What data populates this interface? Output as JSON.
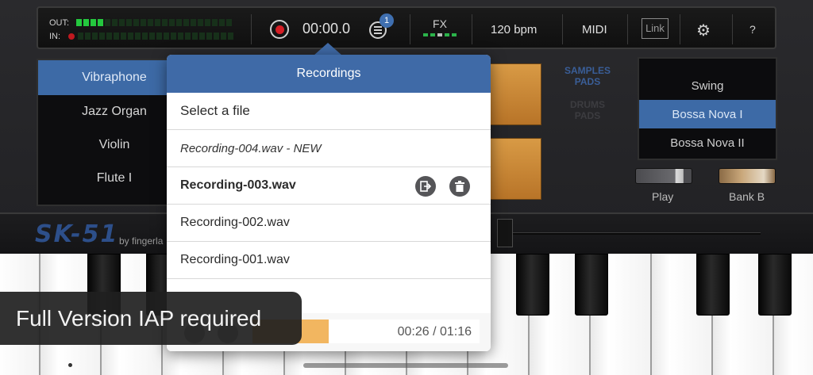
{
  "toolbar": {
    "out_label": "OUT:",
    "in_label": "IN:",
    "out_level": 0.2,
    "in_level": 0.0,
    "time": "00:00.0",
    "recordings_badge": "1",
    "fx_label": "FX",
    "bpm": "120 bpm",
    "midi_label": "MIDI",
    "link_label": "Link",
    "help_label": "?"
  },
  "instruments": {
    "items": [
      "Vibraphone",
      "Jazz Organ",
      "Violin",
      "Flute I"
    ],
    "selected": "Vibraphone"
  },
  "pads": {
    "samples_label_1": "SAMPLES",
    "samples_label_2": "PADS",
    "drums_label_1": "DRUMS",
    "drums_label_2": "PADS"
  },
  "styles": {
    "items": [
      "Swing",
      "Bossa Nova I",
      "Bossa Nova II"
    ],
    "selected": "Bossa Nova I"
  },
  "switches": {
    "play_label": "Play",
    "bank_label": "Bank B"
  },
  "brand": {
    "logo": "SK-51",
    "by": "by fingerla"
  },
  "recordings": {
    "title": "Recordings",
    "select_prompt": "Select a file",
    "files": [
      "Recording-004.wav - NEW",
      "Recording-003.wav",
      "Recording-002.wav",
      "Recording-001.wav"
    ],
    "active_file": "Recording-003.wav",
    "player_time": "00:26 / 01:16",
    "progress": 0.34
  },
  "toast": {
    "message": "Full Version IAP required"
  },
  "colors": {
    "accent": "#3f6aa7",
    "pad": "#c8842f",
    "progress": "#f2b660",
    "meter_green": "#24c83e",
    "record_red": "#d61e25"
  }
}
